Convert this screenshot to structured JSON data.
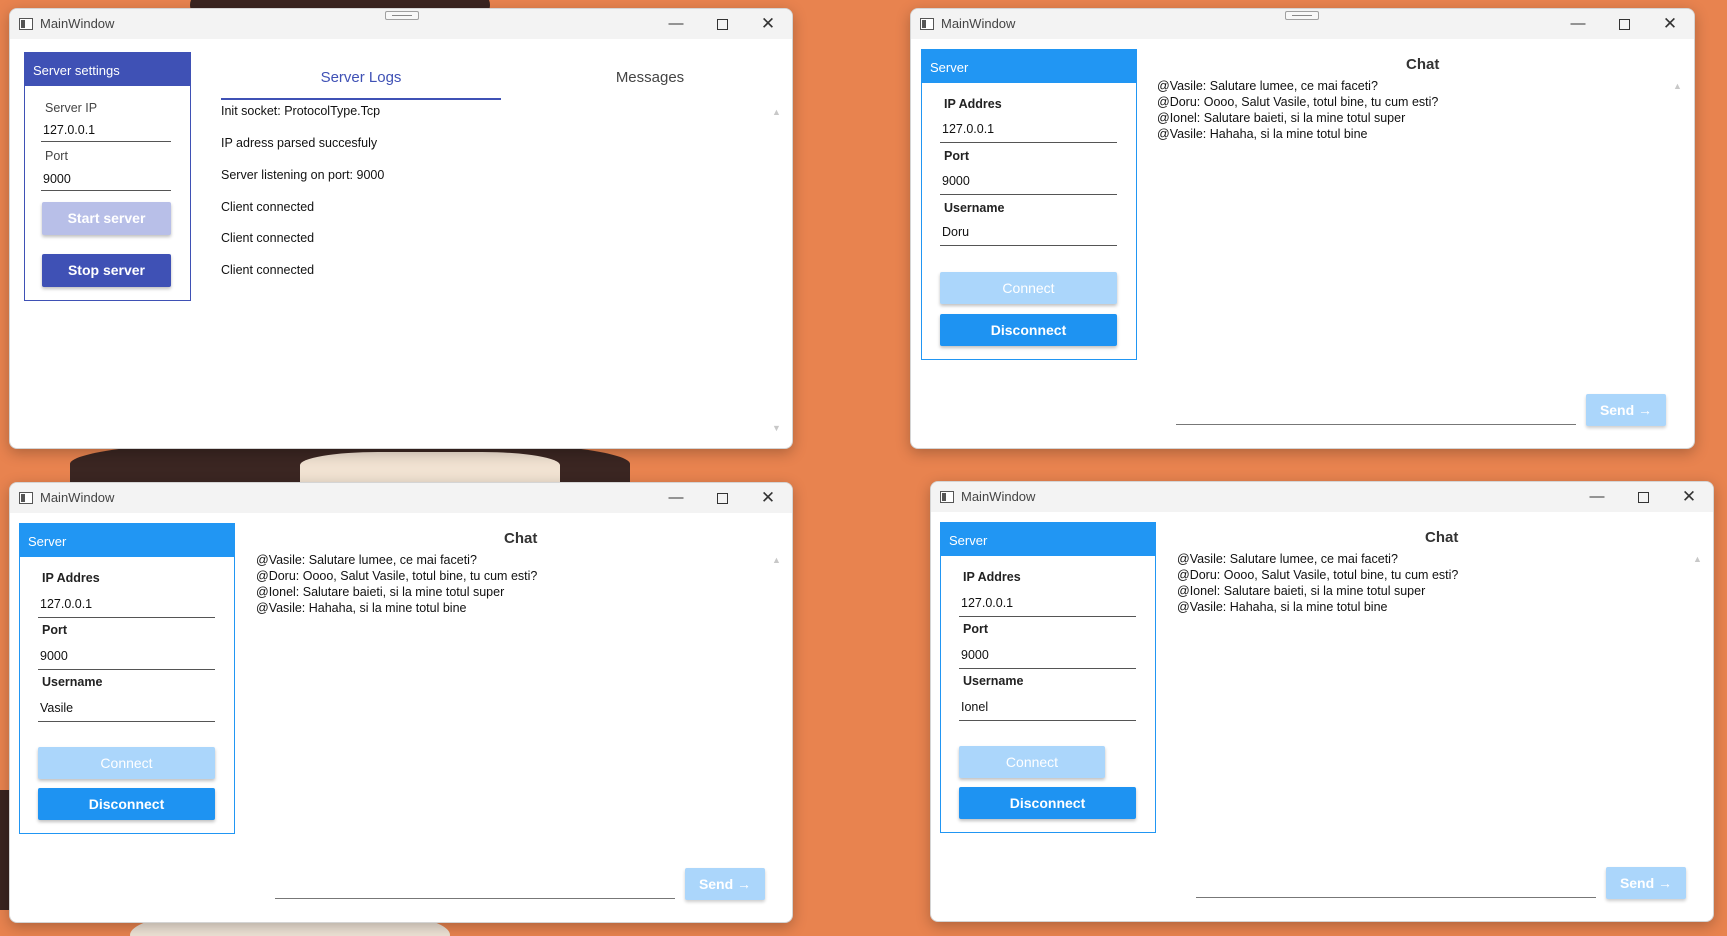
{
  "server_window": {
    "title": "MainWindow",
    "settings_header": "Server settings",
    "ip_label": "Server IP",
    "ip_value": "127.0.0.1",
    "port_label": "Port",
    "port_value": "9000",
    "start_label": "Start server",
    "stop_label": "Stop server",
    "tabs": [
      {
        "label": "Server Logs",
        "active": true
      },
      {
        "label": "Messages",
        "active": false
      }
    ],
    "logs": [
      "Init socket: ProtocolType.Tcp",
      "IP adress parsed succesfuly",
      "Server listening on port: 9000",
      "Client connected",
      "Client connected",
      "Client connected"
    ]
  },
  "client_labels": {
    "panel_header": "Server",
    "ip_label": "IP Addres",
    "port_label": "Port",
    "username_label": "Username",
    "connect_label": "Connect",
    "disconnect_label": "Disconnect",
    "chat_title": "Chat",
    "send_label": "Send →"
  },
  "chat_messages": [
    "@Vasile: Salutare lumee, ce mai faceti?",
    "@Doru: Oooo, Salut Vasile, totul bine, tu cum esti?",
    "@Ionel: Salutare baieti, si la mine totul super",
    "@Vasile: Hahaha, si la mine totul bine"
  ],
  "clients": [
    {
      "title": "MainWindow",
      "ip": "127.0.0.1",
      "port": "9000",
      "username": "Doru"
    },
    {
      "title": "MainWindow",
      "ip": "127.0.0.1",
      "port": "9000",
      "username": "Vasile"
    },
    {
      "title": "MainWindow",
      "ip": "127.0.0.1",
      "port": "9000",
      "username": "Ionel"
    }
  ],
  "colors": {
    "server_accent": "#3f51b5",
    "client_accent": "#2196f3",
    "desktop": "#e8834f"
  },
  "window_controls": {
    "minimize": "—",
    "close": "✕"
  }
}
